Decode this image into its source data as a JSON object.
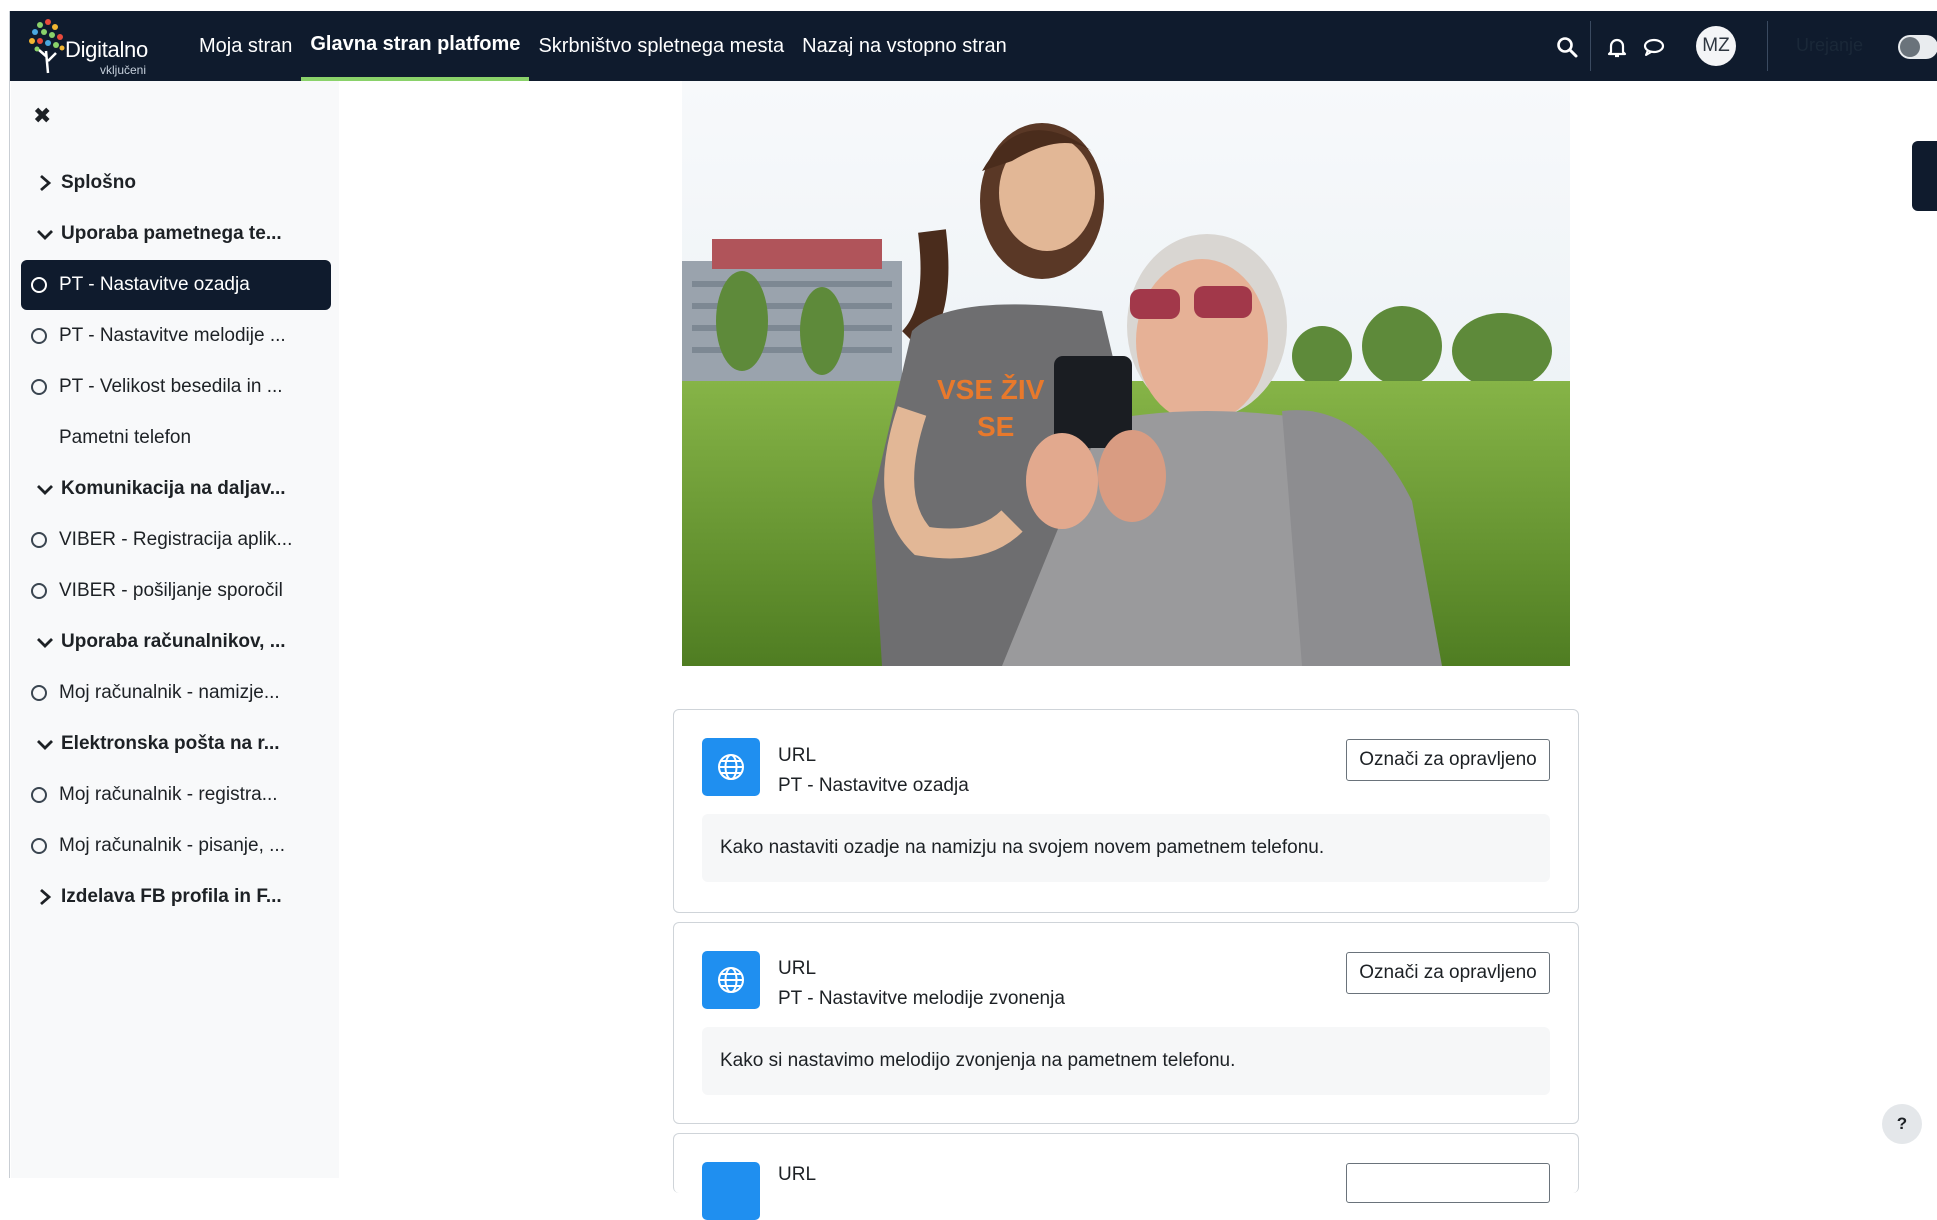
{
  "navbar": {
    "logo_text": "Digitalno",
    "logo_subtext": "vključeni",
    "links": [
      {
        "label": "Moja stran"
      },
      {
        "label": "Glavna stran platfome"
      },
      {
        "label": "Skrbništvo spletnega mesta"
      },
      {
        "label": "Nazaj na vstopno stran"
      }
    ],
    "icons": [
      "search-icon",
      "bell-icon",
      "chat-icon"
    ],
    "avatar_initials": "MZ",
    "edit_mode_label": "Urejanje",
    "edit_mode_on": false
  },
  "drawer": {
    "close_icon": "close-icon",
    "items": [
      {
        "label": "Splošno",
        "kind": "section",
        "expanded": false
      },
      {
        "label": "Uporaba pametnega te...",
        "kind": "section",
        "expanded": true
      },
      {
        "label": "PT - Nastavitve ozadja",
        "kind": "activity",
        "current": true
      },
      {
        "label": "PT - Nastavitve melodije ...",
        "kind": "activity"
      },
      {
        "label": "PT - Velikost besedila in ...",
        "kind": "activity"
      },
      {
        "label": "Pametni telefon",
        "kind": "plain"
      },
      {
        "label": "Komunikacija na daljav...",
        "kind": "section",
        "expanded": true
      },
      {
        "label": "VIBER - Registracija aplik...",
        "kind": "activity"
      },
      {
        "label": "VIBER - pošiljanje sporočil",
        "kind": "activity"
      },
      {
        "label": "Uporaba računalnikov, ...",
        "kind": "section",
        "expanded": true
      },
      {
        "label": "Moj računalnik - namizje...",
        "kind": "activity"
      },
      {
        "label": "Elektronska pošta na r...",
        "kind": "section",
        "expanded": true
      },
      {
        "label": "Moj računalnik - registra...",
        "kind": "activity"
      },
      {
        "label": "Moj računalnik - pisanje, ...",
        "kind": "activity"
      },
      {
        "label": "Izdelava FB profila in F...",
        "kind": "section",
        "expanded": false
      }
    ]
  },
  "hero": {
    "shirt_text_1": "VSE ŽIV",
    "shirt_text_2": "SE"
  },
  "cards": [
    {
      "type": "URL",
      "title": "PT - Nastavitve ozadja",
      "button": "Označi za opravljeno",
      "description": "Kako nastaviti ozadje na namizju na svojem novem pametnem telefonu.",
      "icon": "globe-icon"
    },
    {
      "type": "URL",
      "title": "PT - Nastavitve melodije zvonenja",
      "button": "Označi za opravljeno",
      "description": "Kako si nastavimo melodijo zvonjenja na pametnem telefonu.",
      "icon": "globe-icon"
    },
    {
      "type": "URL",
      "title": "",
      "button": "",
      "description": "",
      "icon": "globe-icon"
    }
  ],
  "help_label": "?",
  "colors": {
    "navbar": "#0f1b2d",
    "active_underline": "#8ad26a",
    "drawer_bg": "#f8f9fa",
    "icon_blue": "#1f8ff0"
  }
}
